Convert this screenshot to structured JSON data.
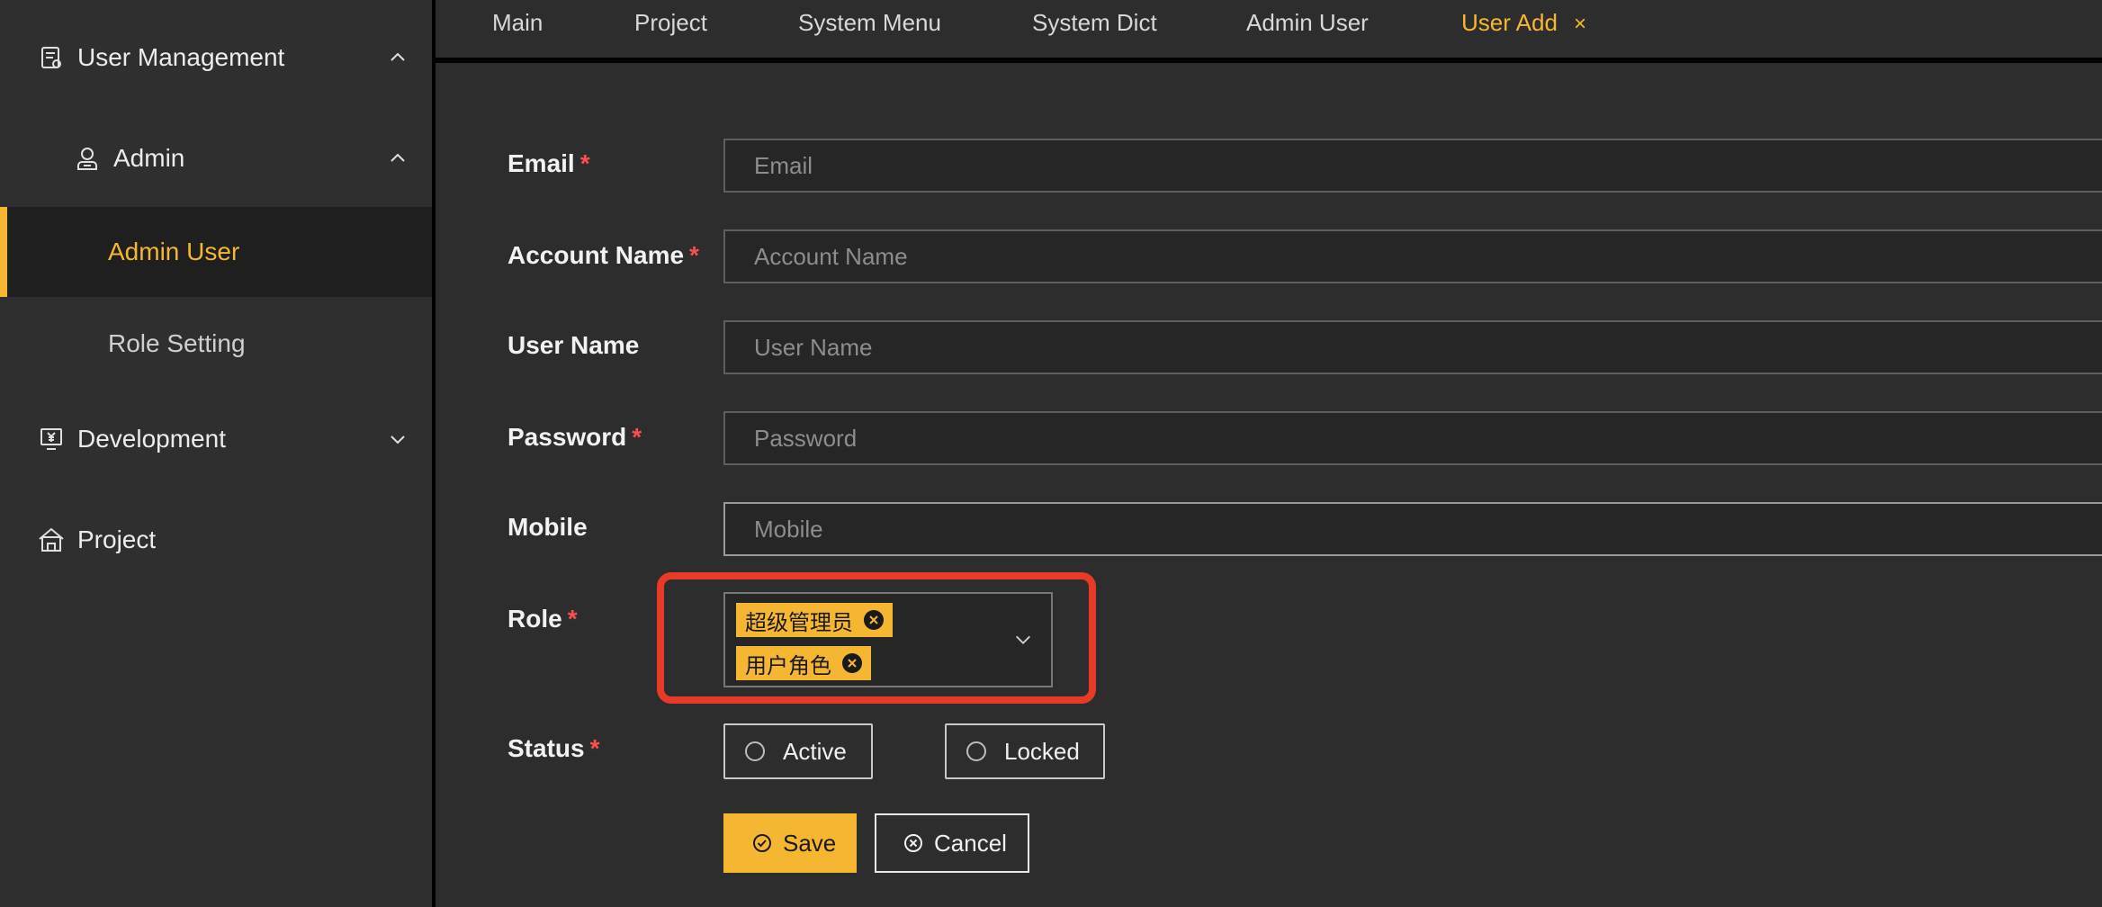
{
  "sidebar": {
    "items": [
      {
        "label": "User Management",
        "icon": "clipboard-icon",
        "expanded": true
      },
      {
        "label": "Admin",
        "icon": "user-icon",
        "expanded": true
      },
      {
        "label": "Admin User",
        "selected": true
      },
      {
        "label": "Role Setting"
      },
      {
        "label": "Development",
        "icon": "monitor-yen-icon",
        "expanded": false
      },
      {
        "label": "Project",
        "icon": "home-icon"
      }
    ]
  },
  "tabs": [
    {
      "label": "Main"
    },
    {
      "label": "Project"
    },
    {
      "label": "System Menu"
    },
    {
      "label": "System Dict"
    },
    {
      "label": "Admin User"
    },
    {
      "label": "User Add",
      "active": true,
      "close": "×"
    }
  ],
  "form": {
    "email": {
      "label": "Email",
      "required": "*",
      "placeholder": "Email",
      "value": ""
    },
    "account_name": {
      "label": "Account Name",
      "required": "*",
      "placeholder": "Account Name",
      "value": ""
    },
    "user_name": {
      "label": "User Name",
      "placeholder": "User Name",
      "value": ""
    },
    "password": {
      "label": "Password",
      "required": "*",
      "placeholder": "Password",
      "value": ""
    },
    "mobile": {
      "label": "Mobile",
      "placeholder": "Mobile",
      "value": ""
    },
    "role": {
      "label": "Role",
      "required": "*",
      "tags": [
        "超级管理员",
        "用户角色"
      ]
    },
    "status": {
      "label": "Status",
      "required": "*",
      "options": [
        "Active",
        "Locked"
      ]
    },
    "save_label": "Save",
    "cancel_label": "Cancel"
  },
  "colors": {
    "accent": "#f5b731",
    "required": "#ff4d4f",
    "highlight": "#e83a28",
    "background": "#2d2d2d"
  }
}
